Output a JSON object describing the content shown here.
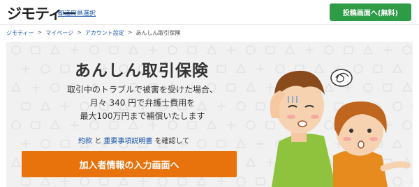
{
  "header": {
    "logo": "ジモティー",
    "pref_link": "都道府県選択",
    "post_button": "投稿画面へ(無料)"
  },
  "breadcrumb": [
    "ジモティー",
    "マイページ",
    "アカウント設定",
    "あんしん取引保険"
  ],
  "breadcrumb_sep": ">",
  "hero": {
    "title": "あんしん取引保険",
    "desc_lines": [
      "取引中のトラブルで被害を受けた場合、",
      "月々 340 円で弁護士費用を",
      "最大100万円まで補償いたします"
    ],
    "terms_link": "約款",
    "and": "と",
    "explain_link": "重要事項説明書",
    "confirm_text": "を確認して",
    "cta_button": "加入者情報の入力画面へ"
  },
  "colors": {
    "brand_green": "#2e9b47",
    "link_blue": "#1a55a8",
    "cta_orange": "#e8720c"
  }
}
